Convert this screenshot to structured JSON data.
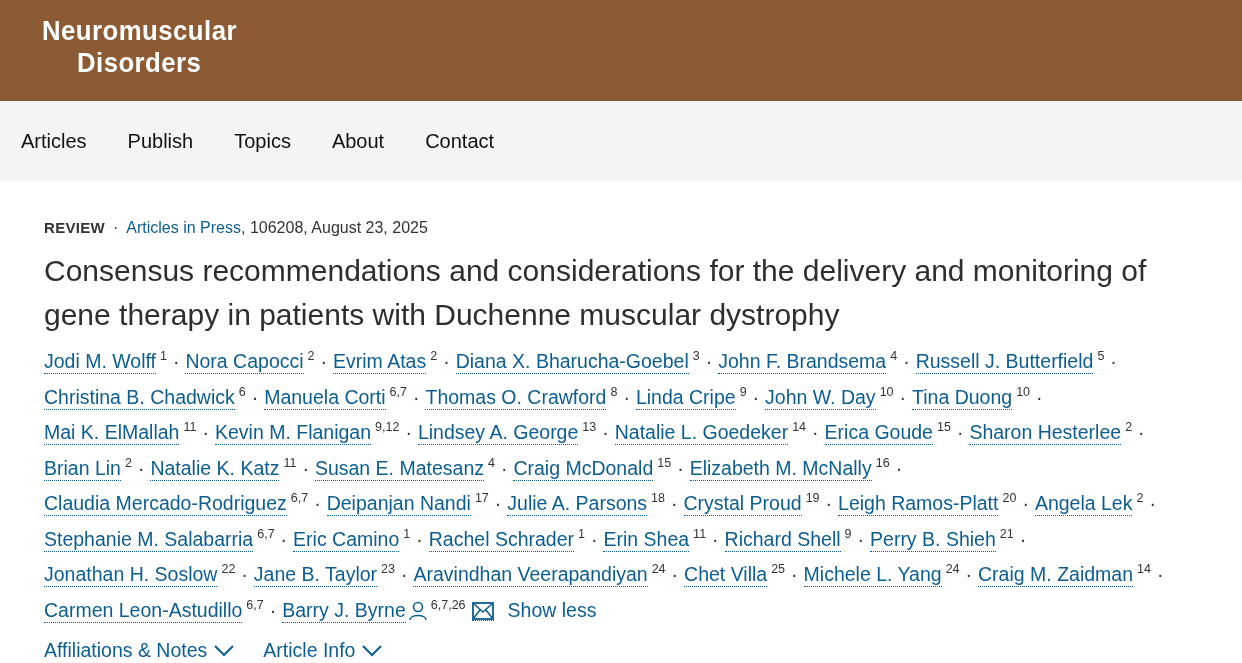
{
  "journal": {
    "title_lines": [
      "Neuromuscular",
      "Disorders"
    ]
  },
  "nav": {
    "items": [
      "Articles",
      "Publish",
      "Topics",
      "About",
      "Contact"
    ]
  },
  "article": {
    "type": "REVIEW",
    "separator": "·",
    "source": "Articles in Press",
    "details": ", 106208, August 23, 2025",
    "title": "Consensus recommendations and considerations for the delivery and monitoring of gene therapy in patients with Duchenne muscular dystrophy",
    "author_lines": [
      [
        {
          "name": "Jodi M. Wolff",
          "affiliations": "1",
          "separator": "·"
        },
        {
          "name": "Nora Capocci",
          "affiliations": "2",
          "separator": "·"
        },
        {
          "name": "Evrim Atas",
          "affiliations": "2",
          "separator": "·"
        },
        {
          "name": "Diana X. Bharucha-Goebel",
          "affiliations": "3",
          "separator": "·"
        },
        {
          "name": "John F. Brandsema",
          "affiliations": "4",
          "separator": "·"
        },
        {
          "name": "Russell J. Butterfield",
          "affiliations": "5",
          "separator": "·"
        }
      ],
      [
        {
          "name": "Christina B. Chadwick",
          "affiliations": "6",
          "separator": "·"
        },
        {
          "name": "Manuela Corti",
          "affiliations": "6,7",
          "separator": "·"
        },
        {
          "name": "Thomas O. Crawford",
          "affiliations": "8",
          "separator": "·"
        },
        {
          "name": "Linda Cripe",
          "affiliations": "9",
          "separator": "·"
        },
        {
          "name": "John W. Day",
          "affiliations": "10",
          "separator": "·"
        },
        {
          "name": "Tina Duong",
          "affiliations": "10",
          "separator": "·"
        }
      ],
      [
        {
          "name": "Mai K. ElMallah",
          "affiliations": "11",
          "separator": "·"
        },
        {
          "name": "Kevin M. Flanigan",
          "affiliations": "9,12",
          "separator": "·"
        },
        {
          "name": "Lindsey A. George",
          "affiliations": "13",
          "separator": "·"
        },
        {
          "name": "Natalie L. Goedeker",
          "affiliations": "14",
          "separator": "·"
        },
        {
          "name": "Erica Goude",
          "affiliations": "15",
          "separator": "·"
        },
        {
          "name": "Sharon Hesterlee",
          "affiliations": "2",
          "separator": "·"
        }
      ],
      [
        {
          "name": "Brian Lin",
          "affiliations": "2",
          "separator": "·"
        },
        {
          "name": "Natalie K. Katz",
          "affiliations": "11",
          "separator": "·"
        },
        {
          "name": "Susan E. Matesanz",
          "affiliations": "4",
          "separator": "·"
        },
        {
          "name": "Craig McDonald",
          "affiliations": "15",
          "separator": "·"
        },
        {
          "name": "Elizabeth M. McNally",
          "affiliations": "16",
          "separator": "·"
        }
      ],
      [
        {
          "name": "Claudia Mercado-Rodriguez",
          "affiliations": "6,7",
          "separator": "·"
        },
        {
          "name": "Deipanjan Nandi",
          "affiliations": "17",
          "separator": "·"
        },
        {
          "name": "Julie A. Parsons",
          "affiliations": "18",
          "separator": "·"
        },
        {
          "name": "Crystal Proud",
          "affiliations": "19",
          "separator": "·"
        },
        {
          "name": "Leigh Ramos-Platt",
          "affiliations": "20",
          "separator": "·"
        },
        {
          "name": "Angela Lek",
          "affiliations": "2",
          "separator": "·"
        }
      ],
      [
        {
          "name": "Stephanie M. Salabarria",
          "affiliations": "6,7",
          "separator": "·"
        },
        {
          "name": "Eric Camino",
          "affiliations": "1",
          "separator": "·"
        },
        {
          "name": "Rachel Schrader",
          "affiliations": "1",
          "separator": "·"
        },
        {
          "name": "Erin Shea",
          "affiliations": "11",
          "separator": "·"
        },
        {
          "name": "Richard Shell",
          "affiliations": "9",
          "separator": "·"
        },
        {
          "name": "Perry B. Shieh",
          "affiliations": "21",
          "separator": "·"
        }
      ],
      [
        {
          "name": "Jonathan H. Soslow",
          "affiliations": "22",
          "separator": "·"
        },
        {
          "name": "Jane B. Taylor",
          "affiliations": "23",
          "separator": "·"
        },
        {
          "name": "Aravindhan Veerapandiyan",
          "affiliations": "24",
          "separator": "·"
        },
        {
          "name": "Chet Villa",
          "affiliations": "25",
          "separator": "·"
        },
        {
          "name": "Michele L. Yang",
          "affiliations": "24",
          "separator": "·"
        },
        {
          "name": "Craig M. Zaidman",
          "affiliations": "14",
          "separator": "·"
        }
      ],
      [
        {
          "name": "Carmen Leon-Astudillo",
          "affiliations": "6,7",
          "separator": "·"
        },
        {
          "name": "Barry J. Byrne",
          "affiliations": "6,7,26",
          "corresponding": true
        }
      ]
    ],
    "show_less": "Show less",
    "sections": [
      {
        "label": "Affiliations & Notes",
        "expanded": false
      },
      {
        "label": "Article Info",
        "expanded": false
      }
    ]
  }
}
